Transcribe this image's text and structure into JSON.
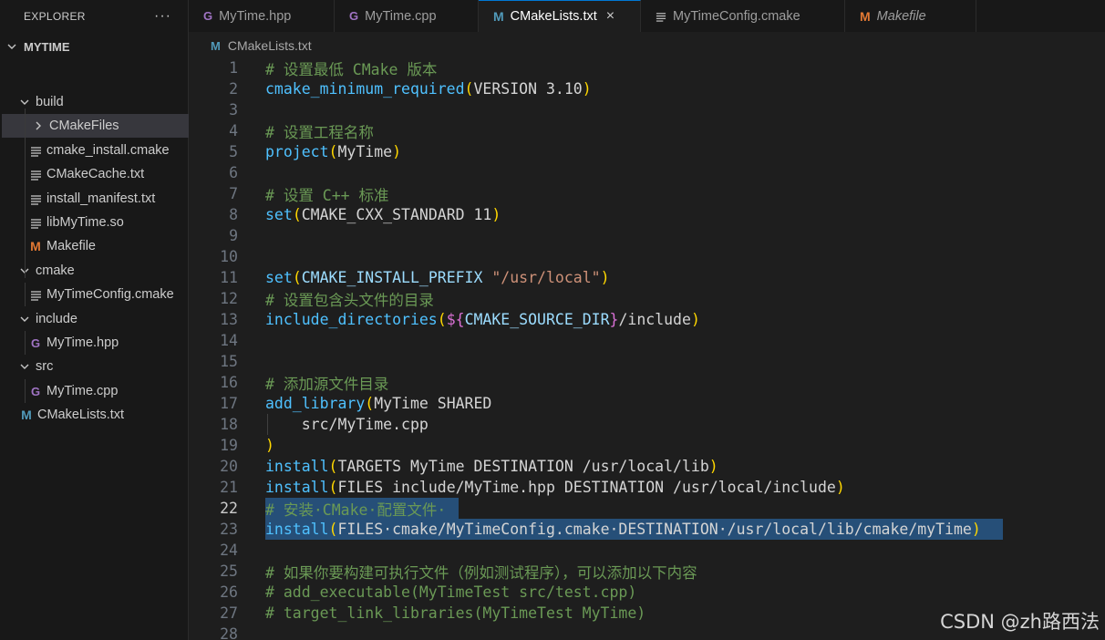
{
  "sidebar": {
    "title": "EXPLORER",
    "more": "···",
    "root": "MYTIME",
    "items": [
      {
        "label": "build",
        "type": "folder"
      },
      {
        "label": "CMakeFiles",
        "type": "folder-collapsed"
      },
      {
        "label": "cmake_install.cmake",
        "type": "file-lines"
      },
      {
        "label": "CMakeCache.txt",
        "type": "file-lines"
      },
      {
        "label": "install_manifest.txt",
        "type": "file-lines"
      },
      {
        "label": "libMyTime.so",
        "type": "file-lines"
      },
      {
        "label": "Makefile",
        "type": "makefile"
      },
      {
        "label": "cmake",
        "type": "folder"
      },
      {
        "label": "MyTimeConfig.cmake",
        "type": "file-lines"
      },
      {
        "label": "include",
        "type": "folder"
      },
      {
        "label": "MyTime.hpp",
        "type": "cpp"
      },
      {
        "label": "src",
        "type": "folder"
      },
      {
        "label": "MyTime.cpp",
        "type": "cpp"
      },
      {
        "label": "CMakeLists.txt",
        "type": "cmake"
      }
    ]
  },
  "tabs": [
    {
      "label": "MyTime.hpp",
      "icon": "G"
    },
    {
      "label": "MyTime.cpp",
      "icon": "G"
    },
    {
      "label": "CMakeLists.txt",
      "icon": "M",
      "close": "×"
    },
    {
      "label": "MyTimeConfig.cmake",
      "icon": "lines"
    },
    {
      "label": "Makefile",
      "icon": "M"
    }
  ],
  "breadcrumb": {
    "icon": "M",
    "label": "CMakeLists.txt"
  },
  "editor": {
    "current_line": 22,
    "lines": [
      {
        "n": "1",
        "segs": [
          {
            "t": "# 设置最低 CMake 版本",
            "c": "c-cmt"
          }
        ]
      },
      {
        "n": "2",
        "segs": [
          {
            "t": "cmake_minimum_required",
            "c": "c-fn"
          },
          {
            "t": "(",
            "c": "c-br"
          },
          {
            "t": "VERSION 3.10",
            "c": "c-pl"
          },
          {
            "t": ")",
            "c": "c-br"
          }
        ]
      },
      {
        "n": "3",
        "segs": []
      },
      {
        "n": "4",
        "segs": [
          {
            "t": "# 设置工程名称",
            "c": "c-cmt"
          }
        ]
      },
      {
        "n": "5",
        "segs": [
          {
            "t": "project",
            "c": "c-fn"
          },
          {
            "t": "(",
            "c": "c-br"
          },
          {
            "t": "MyTime",
            "c": "c-pl"
          },
          {
            "t": ")",
            "c": "c-br"
          }
        ]
      },
      {
        "n": "6",
        "segs": []
      },
      {
        "n": "7",
        "segs": [
          {
            "t": "# 设置 C++ 标准",
            "c": "c-cmt"
          }
        ]
      },
      {
        "n": "8",
        "segs": [
          {
            "t": "set",
            "c": "c-fn"
          },
          {
            "t": "(",
            "c": "c-br"
          },
          {
            "t": "CMAKE_CXX_STANDARD 11",
            "c": "c-pl"
          },
          {
            "t": ")",
            "c": "c-br"
          }
        ]
      },
      {
        "n": "9",
        "segs": []
      },
      {
        "n": "10",
        "segs": []
      },
      {
        "n": "11",
        "segs": [
          {
            "t": "set",
            "c": "c-fn"
          },
          {
            "t": "(",
            "c": "c-br"
          },
          {
            "t": "CMAKE_INSTALL_PREFIX",
            "c": "c-var"
          },
          {
            "t": " ",
            "c": "c-pl"
          },
          {
            "t": "\"/usr/local\"",
            "c": "c-str"
          },
          {
            "t": ")",
            "c": "c-br"
          }
        ]
      },
      {
        "n": "12",
        "segs": [
          {
            "t": "# 设置包含头文件的目录",
            "c": "c-cmt"
          }
        ]
      },
      {
        "n": "13",
        "segs": [
          {
            "t": "include_directories",
            "c": "c-fn"
          },
          {
            "t": "(",
            "c": "c-br"
          },
          {
            "t": "${",
            "c": "c-br2"
          },
          {
            "t": "CMAKE_SOURCE_DIR",
            "c": "c-var"
          },
          {
            "t": "}",
            "c": "c-br2"
          },
          {
            "t": "/include",
            "c": "c-pl"
          },
          {
            "t": ")",
            "c": "c-br"
          }
        ]
      },
      {
        "n": "14",
        "segs": []
      },
      {
        "n": "15",
        "segs": []
      },
      {
        "n": "16",
        "segs": [
          {
            "t": "# 添加源文件目录",
            "c": "c-cmt"
          }
        ]
      },
      {
        "n": "17",
        "segs": [
          {
            "t": "add_library",
            "c": "c-fn"
          },
          {
            "t": "(",
            "c": "c-br"
          },
          {
            "t": "MyTime SHARED",
            "c": "c-pl"
          }
        ]
      },
      {
        "n": "18",
        "segs": [
          {
            "t": "    src/MyTime.cpp",
            "c": "c-pl"
          }
        ]
      },
      {
        "n": "19",
        "segs": [
          {
            "t": ")",
            "c": "c-br"
          }
        ]
      },
      {
        "n": "20",
        "segs": [
          {
            "t": "install",
            "c": "c-fn"
          },
          {
            "t": "(",
            "c": "c-br"
          },
          {
            "t": "TARGETS MyTime DESTINATION /usr/local/lib",
            "c": "c-pl"
          },
          {
            "t": ")",
            "c": "c-br"
          }
        ]
      },
      {
        "n": "21",
        "segs": [
          {
            "t": "install",
            "c": "c-fn"
          },
          {
            "t": "(",
            "c": "c-br"
          },
          {
            "t": "FILES include/MyTime.hpp DESTINATION /usr/local/include",
            "c": "c-pl"
          },
          {
            "t": ")",
            "c": "c-br"
          }
        ]
      },
      {
        "n": "22",
        "segs": [
          {
            "t": "# 安装·CMake·配置文件·",
            "c": "c-cmt"
          }
        ]
      },
      {
        "n": "23",
        "segs": [
          {
            "t": "install",
            "c": "c-fn"
          },
          {
            "t": "(",
            "c": "c-br"
          },
          {
            "t": "FILES·cmake/MyTimeConfig.cmake·DESTINATION·/usr/local/lib/cmake/myTime",
            "c": "c-pl"
          },
          {
            "t": ")",
            "c": "c-br"
          }
        ]
      },
      {
        "n": "24",
        "segs": []
      },
      {
        "n": "25",
        "segs": [
          {
            "t": "# 如果你要构建可执行文件（例如测试程序），可以添加以下内容",
            "c": "c-cmt"
          }
        ]
      },
      {
        "n": "26",
        "segs": [
          {
            "t": "# add_executable(MyTimeTest src/test.cpp)",
            "c": "c-cmt"
          }
        ]
      },
      {
        "n": "27",
        "segs": [
          {
            "t": "# target_link_libraries(MyTimeTest MyTime)",
            "c": "c-cmt"
          }
        ]
      },
      {
        "n": "28",
        "segs": []
      }
    ]
  },
  "watermark": "CSDN @zh路西法"
}
